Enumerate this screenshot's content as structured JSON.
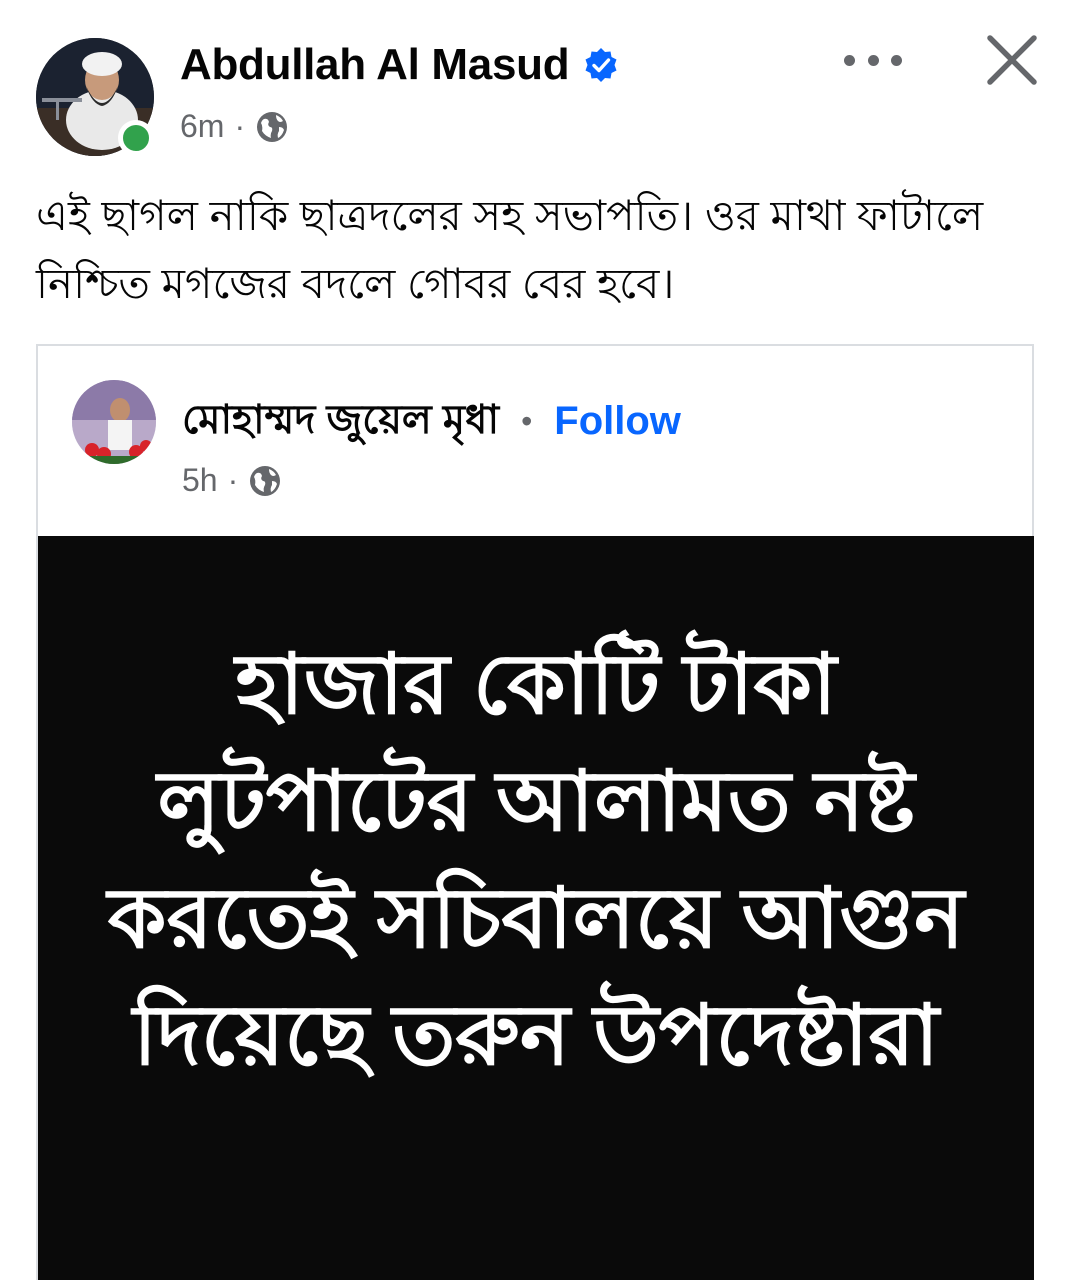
{
  "post": {
    "author_name": "Abdullah Al Masud",
    "time": "6m",
    "separator": "·",
    "body_text": "এই ছাগল নাকি ছাত্রদলের সহ সভাপতি। ওর মাথা ফাটালে নিশ্চিত মগজের বদলে গোবর বের হবে।"
  },
  "shared_post": {
    "author_name": "মোহাম্মদ জুয়েল মৃধা",
    "separator": "•",
    "follow_label": "Follow",
    "time": "5h",
    "time_separator": "·",
    "image_text": "হাজার কোটি টাকা লুটপাটের আলামত নষ্ট করতেই সচিবালয়ে আগুন দিয়েছে তরুন উপদেষ্টারা"
  },
  "icons": {
    "verified": "verified-badge-icon",
    "privacy": "globe-icon",
    "more": "more-options-icon",
    "close": "close-icon",
    "online": "online-status-icon"
  },
  "colors": {
    "verified_blue": "#0866ff",
    "online_green": "#31a24c",
    "follow_blue": "#0866ff",
    "meta_gray": "#65676b",
    "image_bg": "#0a0a0a"
  }
}
